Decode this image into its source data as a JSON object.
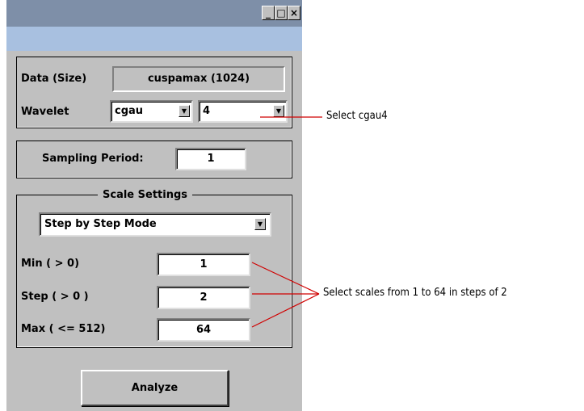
{
  "window": {
    "minimize_glyph": "_",
    "maximize_glyph": "□",
    "close_glyph": "×"
  },
  "data_panel": {
    "data_label": "Data  (Size)",
    "data_value": "cuspamax  (1024)",
    "wavelet_label": "Wavelet",
    "wavelet_family": "cgau",
    "wavelet_number": "4"
  },
  "sampling": {
    "label": "Sampling Period:",
    "value": "1"
  },
  "scale_settings": {
    "title": "Scale Settings",
    "mode": "Step by Step Mode",
    "min_label": "Min  ( > 0)",
    "min_value": "1",
    "step_label": "Step ( > 0 )",
    "step_value": "2",
    "max_label": "Max  ( <= 512)",
    "max_value": "64"
  },
  "analyze_label": "Analyze",
  "annotations": {
    "wavelet_note": "Select cgau4",
    "scales_note": "Select scales from 1 to 64 in steps of 2"
  }
}
